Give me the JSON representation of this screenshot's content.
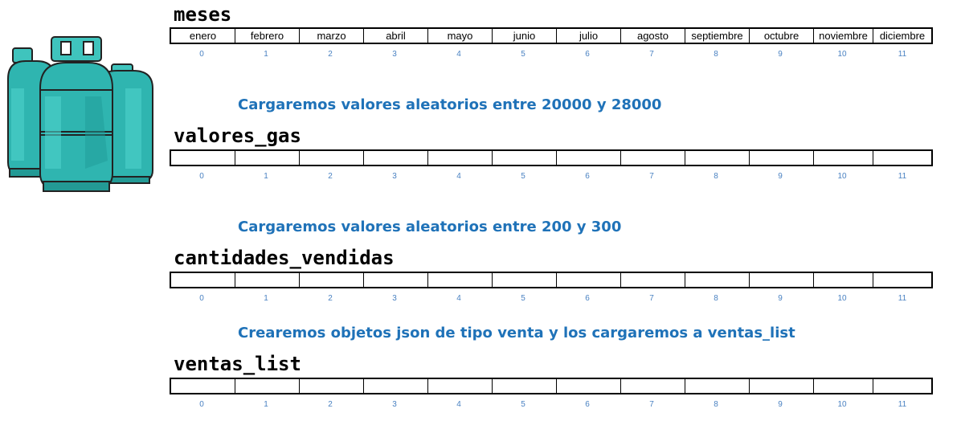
{
  "colors": {
    "caption": "#1f72b8",
    "index": "#4a82c2",
    "cylinder": "#2fb5b0"
  },
  "cylinder_icon": "gas-cylinders-icon",
  "indices": [
    "0",
    "1",
    "2",
    "3",
    "4",
    "5",
    "6",
    "7",
    "8",
    "9",
    "10",
    "11"
  ],
  "sections": [
    {
      "title": "meses",
      "caption": "",
      "cells": [
        "enero",
        "febrero",
        "marzo",
        "abril",
        "mayo",
        "junio",
        "julio",
        "agosto",
        "septiembre",
        "octubre",
        "noviembre",
        "diciembre"
      ]
    },
    {
      "title": "valores_gas",
      "caption": "Cargaremos valores aleatorios entre 20000 y 28000",
      "cells": [
        "",
        "",
        "",
        "",
        "",
        "",
        "",
        "",
        "",
        "",
        "",
        ""
      ]
    },
    {
      "title": "cantidades_vendidas",
      "caption": "Cargaremos valores aleatorios entre 200 y  300",
      "cells": [
        "",
        "",
        "",
        "",
        "",
        "",
        "",
        "",
        "",
        "",
        "",
        ""
      ]
    },
    {
      "title": "ventas_list",
      "caption": "Crearemos objetos json de tipo venta y los cargaremos a ventas_list",
      "cells": [
        "",
        "",
        "",
        "",
        "",
        "",
        "",
        "",
        "",
        "",
        "",
        ""
      ]
    }
  ]
}
